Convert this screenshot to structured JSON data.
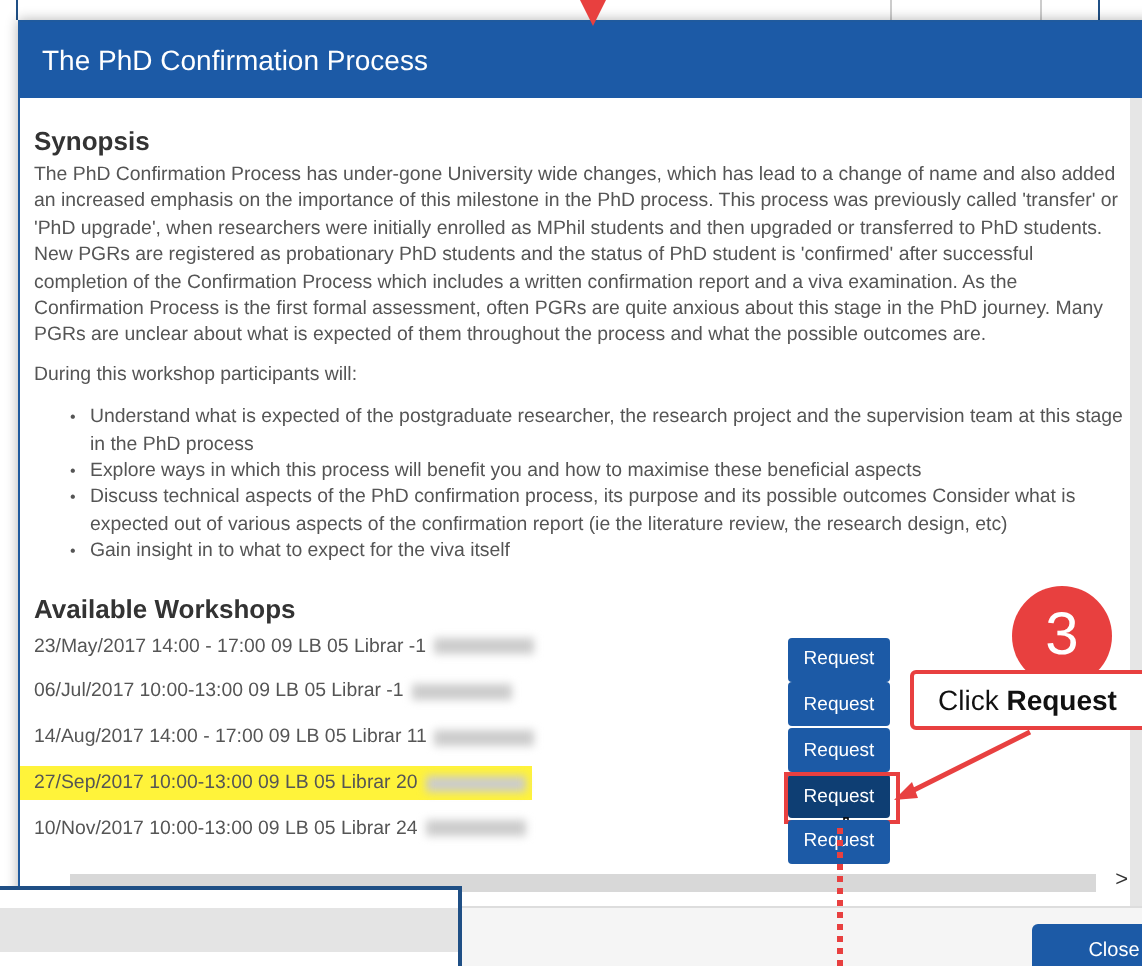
{
  "dialog": {
    "title": "The PhD Confirmation Process",
    "synopsis": {
      "heading": "Synopsis",
      "paragraph": "The PhD Confirmation Process has under-gone University wide changes, which has lead to a change of name and also added an increased emphasis on the importance of this milestone in the PhD process. This process was previously called 'transfer' or 'PhD upgrade', when researchers were initially enrolled as MPhil students and then upgraded or transferred to PhD students. New PGRs are registered as probationary PhD students and the status of PhD student is 'confirmed' after successful completion of the Confirmation Process which includes a written confirmation report and a viva examination. As the Confirmation Process is the first formal assessment, often PGRs are quite anxious about this stage in the PhD journey. Many PGRs are unclear about what is expected of them throughout the process and what the possible outcomes are.",
      "intro": "During this workshop participants will:",
      "bullets": [
        {
          "marker": "•",
          "text": "Understand what is expected of the postgraduate researcher, the research project and the supervision team at this stage in the PhD process"
        },
        {
          "marker": "•",
          "text": "Explore ways in which this process will benefit you and how to maximise these beneficial aspects"
        },
        {
          "marker": "•",
          "text": "Discuss technical aspects of the PhD confirmation process, its purpose and its possible outcomes Consider what is expected out of various aspects of the confirmation report (ie the literature review, the research design, etc)"
        },
        {
          "marker": "•",
          "text": "Gain insight in to what to expect for the viva itself"
        }
      ]
    },
    "workshops": {
      "heading": "Available Workshops",
      "rows": [
        {
          "text": "23/May/2017 14:00 - 17:00 09 LB 05 Librar -1",
          "name_blurred": true,
          "highlighted": false,
          "annotated": false,
          "button": "Request"
        },
        {
          "text": "06/Jul/2017 10:00-13:00 09 LB 05 Librar -1",
          "name_blurred": true,
          "highlighted": false,
          "annotated": false,
          "button": "Request"
        },
        {
          "text": "14/Aug/2017 14:00 - 17:00 09 LB 05 Librar 11",
          "name_blurred": true,
          "highlighted": false,
          "annotated": false,
          "button": "Request"
        },
        {
          "text": "27/Sep/2017 10:00-13:00 09 LB 05 Librar 20",
          "name_blurred": true,
          "highlighted": true,
          "annotated": true,
          "button": "Request"
        },
        {
          "text": "10/Nov/2017 10:00-13:00 09 LB 05 Librar 24",
          "name_blurred": true,
          "highlighted": false,
          "annotated": false,
          "button": "Request"
        }
      ]
    },
    "scroll_right": ">",
    "close_button": "Close"
  },
  "annotation": {
    "step": "3",
    "callout": "Click **Request**"
  }
}
